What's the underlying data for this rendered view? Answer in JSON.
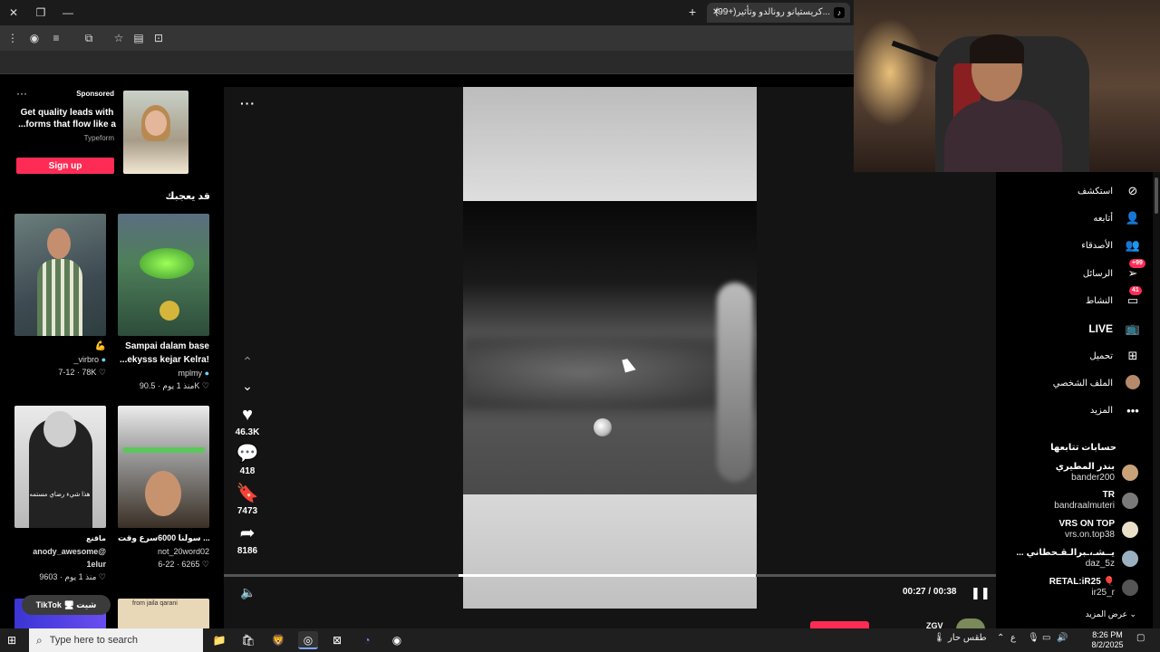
{
  "browser": {
    "tab_title": "(99+)كريستيانو رونالدو وتأثير...",
    "tab_favicon": "tiktok-icon",
    "new_tab_label": "+",
    "close_tab": "✕"
  },
  "sponsored": {
    "label": "Sponsored",
    "headline": "Get quality leads with ...forms that flow like a",
    "brand": "Typeform",
    "cta": "Sign up"
  },
  "suggest_title": "قد يعجبك",
  "videos": [
    {
      "caption": "💪",
      "author": "_virbro",
      "likes": "78K",
      "date": "7-12"
    },
    {
      "caption": "Sampai dalam base ...ekysss kejar Kelra!",
      "author": "mplmy",
      "likes": "90.5K",
      "date": "منذ 1 يوم"
    },
    {
      "caption": "ماقنع",
      "overlay": "هذا شيء رضاي مستمه",
      "author": "anody_awesome@ 1elur",
      "likes": "9603",
      "date": "منذ 1 يوم"
    },
    {
      "caption": "سولنا 6000سرع وقت ...onepiece# لستمر",
      "author": "not_20word02",
      "likes": "6265",
      "date": "6-22"
    }
  ],
  "bottom_thumb_label": "from jaila qarani",
  "tiktok_pill": "TikTok 🖥 شيت",
  "actions": {
    "likes": "46.3K",
    "comments": "418",
    "saves": "7473",
    "shares": "8186"
  },
  "player": {
    "time": "00:27 / 00:38",
    "progress": 0.71,
    "bottom_text": "ZGV"
  },
  "nav": [
    {
      "label": "استكشف",
      "icon": "compass-icon"
    },
    {
      "label": "أتابعه",
      "icon": "user-follow-icon"
    },
    {
      "label": "الأصدقاء",
      "icon": "friends-icon"
    },
    {
      "label": "الرسائل",
      "icon": "send-icon",
      "badge": "+99"
    },
    {
      "label": "النشاط",
      "icon": "inbox-icon",
      "badge": "41"
    },
    {
      "label": "LIVE",
      "icon": "live-icon"
    },
    {
      "label": "تحميل",
      "icon": "upload-icon"
    },
    {
      "label": "الملف الشخصي",
      "icon": "profile-avatar-icon"
    },
    {
      "label": "المزيد",
      "icon": "more-icon"
    }
  ],
  "following": {
    "title": "حسابات تتابعها",
    "accounts": [
      {
        "name": "بندر المطيري",
        "handle": "bander200"
      },
      {
        "name": "TR",
        "handle": "bandraalmuteri"
      },
      {
        "name": "VRS ON TOP",
        "handle": "vrs.on.top38"
      },
      {
        "name": "... يــشـ،ـبرالـقـحطاني",
        "handle": "daz_5z"
      },
      {
        "name": "RETAL:iR25 🎈",
        "handle": "ir25_r"
      }
    ],
    "see_more": "عرض المزيد"
  },
  "taskbar": {
    "search_placeholder": "Type here to search",
    "weather": "طقس حار",
    "lang": "ع",
    "time": "8:26 PM",
    "date": "8/2/2025"
  }
}
